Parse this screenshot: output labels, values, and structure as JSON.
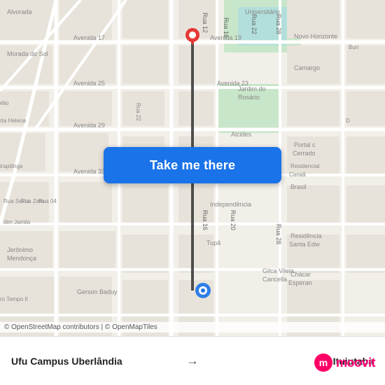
{
  "map": {
    "attribution": "© OpenStreetMap contributors | © OpenMapTiles",
    "button_label": "Take me there",
    "origin": "Ufu Campus Uberlândia",
    "destination": "Ituiutaba",
    "moovit_brand": "moovit",
    "arrow": "→"
  },
  "colors": {
    "button_bg": "#1a73e8",
    "button_text": "#ffffff",
    "route_line": "#333333",
    "origin_pin": "#e53935",
    "dest_pin": "#1a73e8",
    "road_major": "#ffffff",
    "road_minor": "#f5f2ed",
    "map_bg": "#f2efe9",
    "park": "#d4e8c2",
    "block": "#e8e3da"
  }
}
